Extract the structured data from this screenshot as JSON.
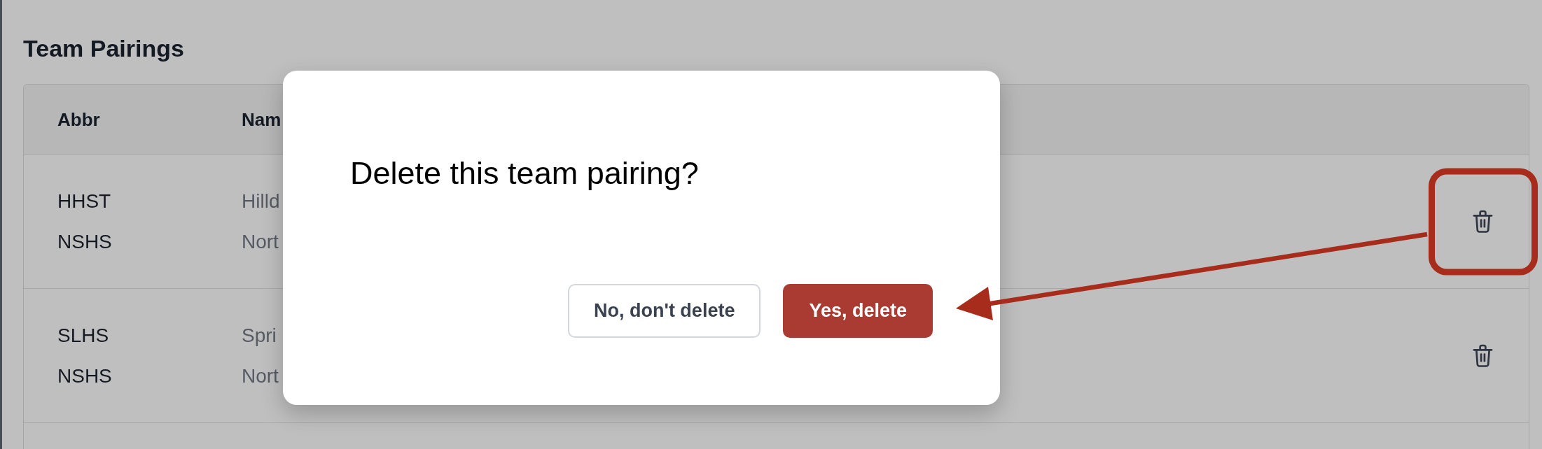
{
  "page": {
    "title": "Team Pairings"
  },
  "table": {
    "columns": [
      "Abbr",
      "Nam"
    ],
    "rows": [
      {
        "teams": [
          {
            "abbr": "HHST",
            "name": "Hilld"
          },
          {
            "abbr": "NSHS",
            "name": "Nort"
          }
        ],
        "delete_highlighted": true
      },
      {
        "teams": [
          {
            "abbr": "SLHS",
            "name": "Spri"
          },
          {
            "abbr": "NSHS",
            "name": "Nort"
          }
        ],
        "delete_highlighted": false
      }
    ]
  },
  "dialog": {
    "title": "Delete this team pairing?",
    "buttons": [
      {
        "label": "No, don't delete",
        "kind": "secondary"
      },
      {
        "label": "Yes, delete",
        "kind": "danger"
      }
    ]
  }
}
